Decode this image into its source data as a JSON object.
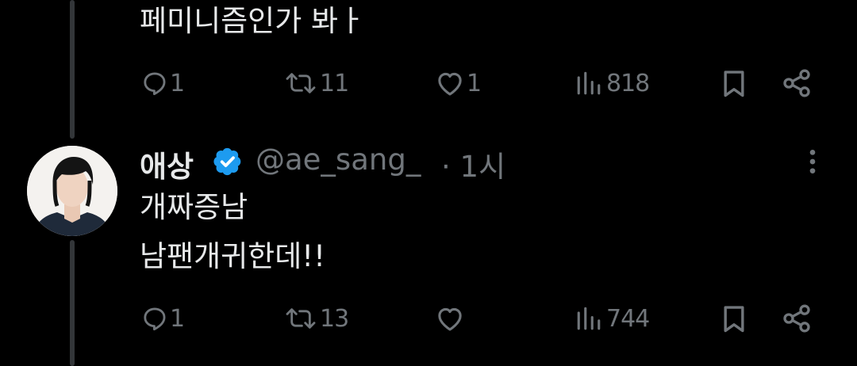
{
  "tweet_above": {
    "text": "페미니즘인가 봐ㅏ",
    "stats": {
      "replies": "1",
      "retweets": "11",
      "likes": "1",
      "views": "818"
    }
  },
  "reply": {
    "display_name": "애상",
    "handle": "@ae_sang_",
    "time": "· 1시",
    "lines": [
      "개짜증남",
      "남팬개귀한데!!"
    ],
    "stats": {
      "replies": "1",
      "retweets": "13",
      "likes": "",
      "views": "744"
    }
  },
  "colors": {
    "background": "#000000",
    "text": "#e7e9ea",
    "muted": "#71767b",
    "verified": "#1d9bf0",
    "thread_line": "#333639"
  },
  "icons": [
    "reply-icon",
    "retweet-icon",
    "like-icon",
    "views-icon",
    "bookmark-icon",
    "share-icon",
    "verified-badge-icon",
    "more-icon"
  ]
}
